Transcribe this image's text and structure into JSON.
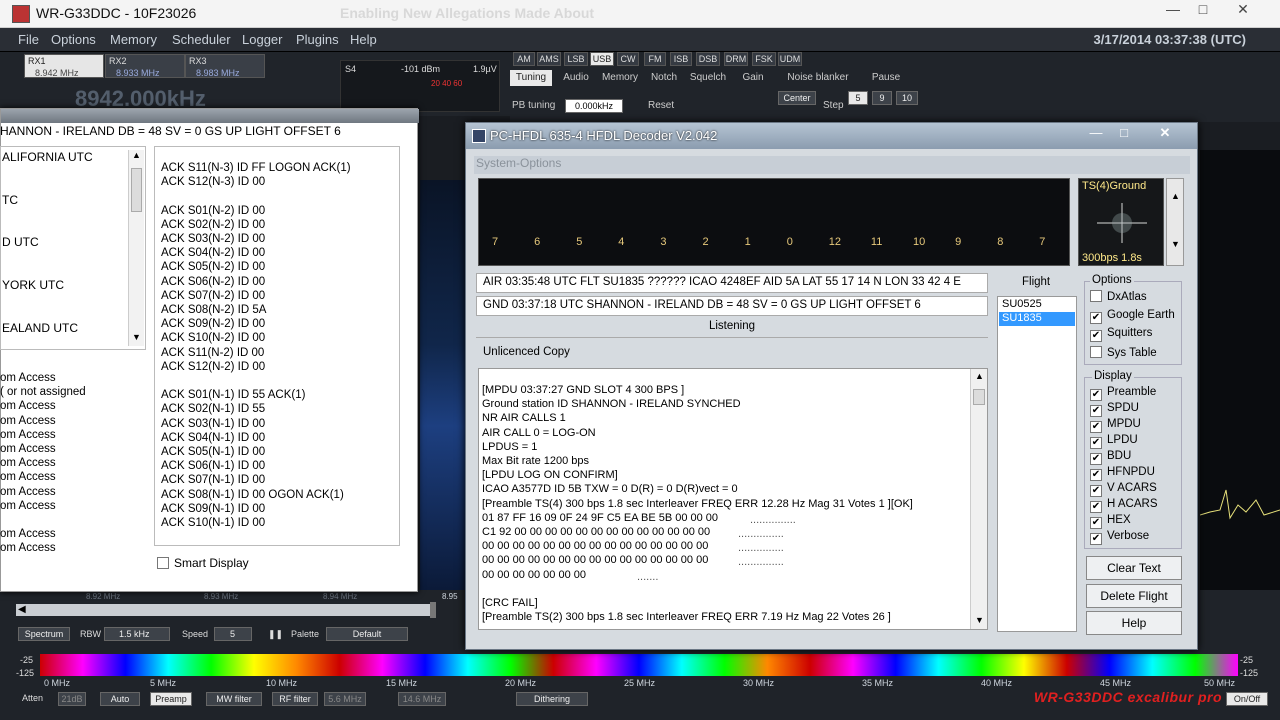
{
  "app": {
    "title": "WR-G33DDC - 10F23026",
    "ghost_title": "Enabling New Allegations Made About",
    "datetime": "3/17/2014 03:37:38 (UTC)",
    "min_icon": "minimize-icon",
    "max_icon": "maximize-icon",
    "close_icon": "close-icon"
  },
  "menu": [
    "File",
    "Options",
    "Memory",
    "Scheduler",
    "Logger",
    "Plugins",
    "Help"
  ],
  "receivers": [
    {
      "name": "RX1",
      "freq": "8.942 MHz"
    },
    {
      "name": "RX2",
      "freq": "8.933 MHz"
    },
    {
      "name": "RX3",
      "freq": "8.983 MHz"
    }
  ],
  "big_freq": "8942.000kHz",
  "smeter": {
    "unit": "S4",
    "dbm": "-101 dBm",
    "uv": "1.9µV",
    "scale": "20  40  60"
  },
  "modes": [
    "AM",
    "AMS",
    "LSB",
    "USB",
    "CW",
    "FM",
    "ISB",
    "DSB",
    "DRM",
    "FSK",
    "UDM"
  ],
  "active_mode": "USB",
  "tabs": [
    "Tuning",
    "Audio",
    "Memory",
    "Notch",
    "Squelch",
    "Gain",
    "Noise blanker",
    "Pause"
  ],
  "pb_tuning": {
    "label": "PB tuning",
    "value": "0.000kHz",
    "reset": "Reset"
  },
  "center": "Center",
  "step": {
    "label": "Step",
    "values": [
      "5",
      "9",
      "10"
    ]
  },
  "left_window": {
    "status": "HANNON - IRELAND  DB = 48  SV = 0  GS UP LIGHT  OFFSET 6",
    "zones": [
      "ALIFORNIA UTC",
      "TC",
      "D UTC",
      "YORK UTC",
      "EALAND UTC"
    ],
    "acks": [
      "ACK S11(N-3) ID FF LOGON ACK(1)",
      "ACK S12(N-3) ID 00",
      "",
      "ACK S01(N-2) ID 00",
      "ACK S02(N-2) ID 00",
      "ACK S03(N-2) ID 00",
      "ACK S04(N-2) ID 00",
      "ACK S05(N-2) ID 00",
      "ACK S06(N-2) ID 00",
      "ACK S07(N-2) ID 00",
      "ACK S08(N-2) ID 5A",
      "ACK S09(N-2) ID 00",
      "ACK S10(N-2) ID 00",
      "ACK S11(N-2) ID 00",
      "ACK S12(N-2) ID 00",
      "",
      "ACK S01(N-1) ID 55  ACK(1)",
      "ACK S02(N-1) ID 55",
      "ACK S03(N-1) ID 00",
      "ACK S04(N-1) ID 00",
      "ACK S05(N-1) ID 00",
      "ACK S06(N-1) ID 00",
      "ACK S07(N-1) ID 00",
      "ACK S08(N-1) ID 00  OGON ACK(1)",
      "ACK S09(N-1) ID 00",
      "ACK S10(N-1) ID 00"
    ],
    "access": [
      "om Access",
      "( or not assigned",
      "om Access",
      "om Access",
      "om Access",
      "om Access",
      "om Access",
      "om Access",
      "om Access",
      "om Access",
      "",
      "om Access",
      "om Access"
    ],
    "smart_display": "Smart Display"
  },
  "decoder": {
    "title": "PC-HFDL 635-4 HFDL Decoder V2.042",
    "system_options": "System-Options",
    "slots": [
      "7",
      "6",
      "5",
      "4",
      "3",
      "2",
      "1",
      "0",
      "12",
      "11",
      "10",
      "9",
      "8",
      "7"
    ],
    "ts_label": "TS(4)Ground",
    "ts_bps": "300bps 1.8s",
    "air_line": "AIR 03:35:48  UTC FLT SU1835 ?????? ICAO 4248EF AID 5A LAT 55 17 14  N  LON 33 42 4  E",
    "gnd_line": "GND 03:37:18 UTC SHANNON - IRELAND  DB = 48  SV = 0  GS UP LIGHT  OFFSET 6",
    "listening": "Listening",
    "unlicenced": "Unlicenced Copy",
    "log": [
      "[MPDU 03:37:27 GND SLOT 4 300 BPS ]",
      "Ground station ID SHANNON - IRELAND SYNCHED",
      "NR AIR CALLS 1",
      "AIR CALL 0 = LOG-ON",
      "LPDUS = 1",
      "Max Bit rate 1200 bps",
      "[LPDU LOG ON CONFIRM]",
      "ICAO A3577D ID 5B TXW = 0 D(R) = 0 D(R)vect = 0",
      "[Preamble TS(4) 300  bps 1.8 sec Interleaver FREQ ERR 12.28 Hz Mag 31 Votes 1 ][OK]",
      "01 87 FF 16 09 0F 24 9F C5 EA BE 5B 00 00 00",
      "C1 92 00 00 00 00 00 00 00 00 00 00 00 00 00",
      "00 00 00 00 00 00 00 00 00 00 00 00 00 00 00",
      "00 00 00 00 00 00 00 00 00 00 00 00 00 00 00",
      "00 00 00 00 00 00 00",
      "",
      "[CRC FAIL]",
      "[Preamble TS(2) 300  bps 1.8 sec Interleaver FREQ ERR 7.19 Hz Mag 22 Votes 26 ]"
    ],
    "log_dots": [
      "...............",
      "...............",
      "...............",
      "...............",
      "......."
    ],
    "flight_label": "Flight",
    "flights": [
      "SU0525",
      "SU1835"
    ],
    "selected_flight": "SU1835",
    "options_label": "Options",
    "options": [
      {
        "label": "DxAtlas",
        "checked": false
      },
      {
        "label": "Google Earth",
        "checked": true
      },
      {
        "label": "Squitters",
        "checked": true
      },
      {
        "label": "Sys Table",
        "checked": false
      }
    ],
    "display_label": "Display",
    "display": [
      {
        "label": "Preamble",
        "checked": true
      },
      {
        "label": "SPDU",
        "checked": true
      },
      {
        "label": "MPDU",
        "checked": true
      },
      {
        "label": "LPDU",
        "checked": true
      },
      {
        "label": "BDU",
        "checked": true
      },
      {
        "label": "HFNPDU",
        "checked": true
      },
      {
        "label": "V ACARS",
        "checked": true
      },
      {
        "label": "H ACARS",
        "checked": true
      },
      {
        "label": "HEX",
        "checked": true
      },
      {
        "label": "Verbose",
        "checked": true
      }
    ],
    "buttons": [
      "Clear Text",
      "Delete Flight",
      "Help"
    ]
  },
  "spectrum_ctrl": {
    "spectrum": "Spectrum",
    "rbw_label": "RBW",
    "rbw": "1.5 kHz",
    "speed_label": "Speed",
    "speed": "5",
    "palette_label": "Palette",
    "palette": "Default",
    "freq_marks": [
      "8.92 MHz",
      "8.93 MHz",
      "8.94 MHz"
    ],
    "right_mark": "8.95"
  },
  "overview": {
    "db_top": "-25",
    "db_bottom": "-125",
    "db_right_top": "-25",
    "db_right_bottom": "-125",
    "ticks": [
      "0 MHz",
      "5 MHz",
      "10 MHz",
      "15 MHz",
      "20 MHz",
      "25 MHz",
      "30 MHz",
      "35 MHz",
      "40 MHz",
      "45 MHz",
      "50 MHz"
    ]
  },
  "bottom": {
    "atten": "Atten",
    "atten_val": "21dB",
    "auto": "Auto",
    "preamp": "Preamp",
    "mw": "MW filter",
    "rf": "RF filter",
    "rf_val": "5.6 MHz",
    "rf_val2": "14.6 MHz",
    "dithering": "Dithering",
    "onoff": "On/Off",
    "brand": "WR-G33DDC excalibur pro"
  },
  "colors": {
    "accent": "#3399ff",
    "brand": "#e02020"
  }
}
